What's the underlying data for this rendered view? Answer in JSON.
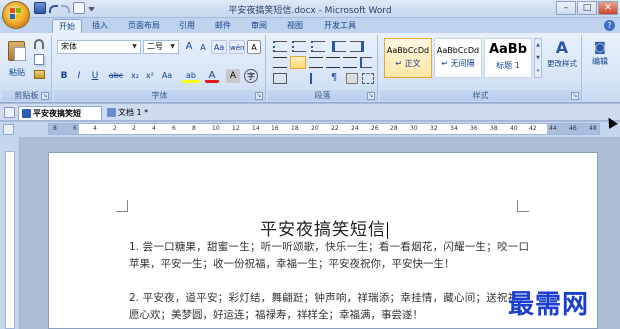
{
  "window": {
    "title": "平安夜搞笑短信.docx - Microsoft Word",
    "minimize": "–",
    "maximize": "□",
    "close": "✕"
  },
  "ribbon_tabs": [
    {
      "label": "开始",
      "active": true
    },
    {
      "label": "插入"
    },
    {
      "label": "页面布局"
    },
    {
      "label": "引用"
    },
    {
      "label": "邮件"
    },
    {
      "label": "审阅"
    },
    {
      "label": "视图"
    },
    {
      "label": "开发工具"
    }
  ],
  "help_label": "?",
  "clipboard": {
    "paste_label": "粘贴",
    "group_label": "剪贴板"
  },
  "font": {
    "font_name": "宋体",
    "font_size": "二号",
    "grow": "A",
    "shrink": "A",
    "clear": "Aa",
    "phonetic": "wén",
    "bold": "B",
    "italic": "I",
    "underline": "U",
    "strike": "abc",
    "subscript": "x₂",
    "superscript": "x²",
    "change_case": "Aa",
    "highlight": "ab",
    "font_color": "A",
    "char_shading": "A",
    "enclose": "字",
    "group_label": "字体"
  },
  "paragraph": {
    "group_label": "段落"
  },
  "styles": {
    "items": [
      {
        "sample": "AaBbCcDd",
        "name": "↵ 正文",
        "selected": true
      },
      {
        "sample": "AaBbCcDd",
        "name": "↵ 无间隔",
        "selected": false
      },
      {
        "sample": "AaBb",
        "name": "标题 1",
        "selected": false
      }
    ],
    "change_styles": "更改样式",
    "group_label": "样式"
  },
  "editing": {
    "label": "编辑"
  },
  "doc_tabs": [
    {
      "label": "平安夜搞笑短信.docx",
      "active": true
    },
    {
      "label": "文档 1 *",
      "active": false
    }
  ],
  "ruler_ticks": [
    "8",
    "6",
    "4",
    "2",
    "2",
    "4",
    "6",
    "8",
    "10",
    "12",
    "14",
    "16",
    "18",
    "20",
    "22",
    "24",
    "26",
    "28",
    "30",
    "32",
    "34",
    "36",
    "38",
    "40",
    "42",
    "44",
    "46",
    "48"
  ],
  "document": {
    "title": "平安夜搞笑短信",
    "paragraphs": [
      "1. 尝一口糖果，甜蜜一生；听一听颂歌，快乐一生；看一看烟花，闪耀一生；咬一口苹果，平安一生；收一份祝福，幸福一生；平安夜祝你，平安快一生！",
      "2. 平安夜，道平安；彩灯结，舞翩跹；钟声响，祥瑞添；幸挂情，藏心间；送祝福，愿心欢；美梦圆，好运连；福禄寿，祥样全；幸福满，事尝遂！"
    ]
  },
  "watermark": "最需网",
  "colors": {
    "ribbon_text": "#15428b",
    "watermark": "#1a3fd0",
    "selected_style": "#e7a93c"
  }
}
